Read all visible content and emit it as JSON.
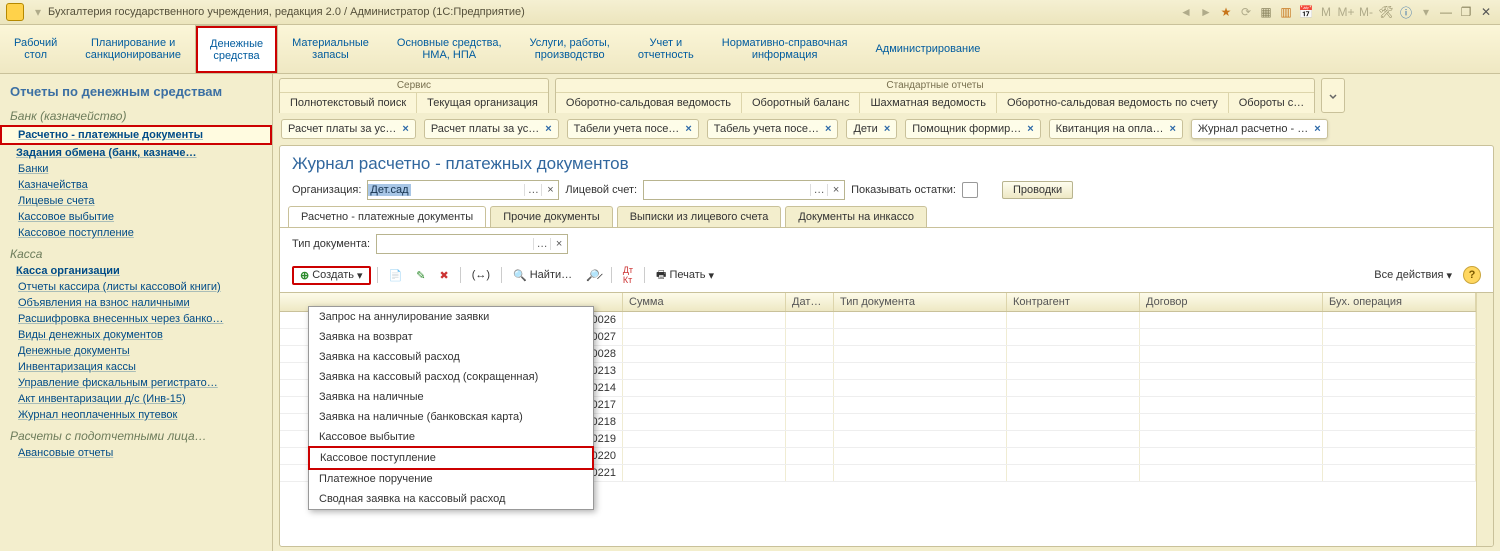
{
  "title": "Бухгалтерия государственного учреждения, редакция 2.0 / Администратор  (1С:Предприятие)",
  "sections": [
    {
      "l1": "Рабочий",
      "l2": "стол"
    },
    {
      "l1": "Планирование и",
      "l2": "санкционирование"
    },
    {
      "l1": "Денежные",
      "l2": "средства",
      "active": true
    },
    {
      "l1": "Материальные",
      "l2": "запасы"
    },
    {
      "l1": "Основные средства,",
      "l2": "НМА, НПА"
    },
    {
      "l1": "Услуги, работы,",
      "l2": "производство"
    },
    {
      "l1": "Учет и",
      "l2": "отчетность"
    },
    {
      "l1": "Нормативно-справочная",
      "l2": "информация"
    },
    {
      "l1": "Администрирование",
      "l2": ""
    }
  ],
  "sidebar": {
    "heading": "Отчеты по денежным средствам",
    "groups": [
      {
        "title": "Банк (казначейство)",
        "items": [
          {
            "label": "Расчетно - платежные документы",
            "bold": true,
            "hl": true
          },
          {
            "label": "Задания обмена (банк, казначе…",
            "bold": true
          },
          {
            "label": "Банки"
          },
          {
            "label": "Казначейства"
          },
          {
            "label": "Лицевые счета"
          },
          {
            "label": "Кассовое выбытие"
          },
          {
            "label": "Кассовое поступление"
          }
        ]
      },
      {
        "title": "Касса",
        "items": [
          {
            "label": "Касса организации",
            "bold": true
          },
          {
            "label": "Отчеты кассира (листы кассовой книги)"
          },
          {
            "label": "Объявления на взнос наличными"
          },
          {
            "label": "Расшифровка внесенных через банко…"
          },
          {
            "label": "Виды денежных документов"
          },
          {
            "label": "Денежные документы"
          },
          {
            "label": "Инвентаризация кассы"
          },
          {
            "label": "Управление фискальным регистрато…"
          },
          {
            "label": "Акт инвентаризации д/с (Инв-15)"
          },
          {
            "label": "Журнал неоплаченных путевок"
          }
        ]
      },
      {
        "title": "Расчеты с подотчетными лица…",
        "items": [
          {
            "label": "Авансовые отчеты"
          }
        ]
      }
    ]
  },
  "service_groups": [
    {
      "title": "Сервис",
      "items": [
        "Полнотекстовый поиск",
        "Текущая организация"
      ]
    },
    {
      "title": "Стандартные отчеты",
      "items": [
        "Оборотно-сальдовая ведомость",
        "Оборотный баланс",
        "Шахматная ведомость",
        "Оборотно-сальдовая ведомость по счету",
        "Обороты с…"
      ]
    }
  ],
  "window_tabs": [
    {
      "label": "Расчет платы за ус…"
    },
    {
      "label": "Расчет платы за ус…"
    },
    {
      "label": "Табели учета посе…"
    },
    {
      "label": "Табель учета посе…"
    },
    {
      "label": "Дети"
    },
    {
      "label": "Помощник формир…"
    },
    {
      "label": "Квитанция на опла…"
    },
    {
      "label": "Журнал расчетно - …",
      "active": true
    }
  ],
  "page": {
    "title": "Журнал расчетно - платежных документов",
    "filters": {
      "org_label": "Организация:",
      "org_value": "Дет.сад",
      "acc_label": "Лицевой счет:",
      "acc_value": "",
      "show_balance": "Показывать остатки:",
      "postings": "Проводки"
    },
    "subtabs": [
      "Расчетно - платежные документы",
      "Прочие документы",
      "Выписки из лицевого счета",
      "Документы на инкассо"
    ],
    "doctype_label": "Тип документа:",
    "toolbar": {
      "create": "Создать",
      "find": "Найти…",
      "print": "Печать",
      "all_actions": "Все действия"
    },
    "columns": [
      "",
      "Сумма",
      "Дат…",
      "Тип документа",
      "Контрагент",
      "Договор",
      "Бух. операция"
    ],
    "rows": [
      "00026",
      "00027",
      "00028",
      "00213",
      "00214",
      "00217",
      "00218",
      "00219",
      "00220",
      "00221"
    ]
  },
  "dropdown": [
    "Запрос на аннулирование заявки",
    "Заявка на возврат",
    "Заявка на кассовый расход",
    "Заявка на кассовый расход (сокращенная)",
    "Заявка на наличные",
    "Заявка на наличные (банковская карта)",
    "Кассовое выбытие",
    "Кассовое поступление",
    "Платежное поручение",
    "Сводная заявка на кассовый расход"
  ],
  "dropdown_hl_index": 7
}
